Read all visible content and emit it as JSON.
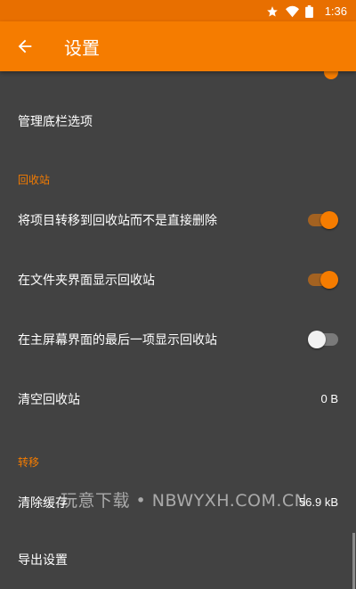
{
  "status_bar": {
    "time": "1:36",
    "icons": [
      "star-icon",
      "wifi-icon",
      "battery-icon"
    ]
  },
  "app_bar": {
    "title": "设置",
    "back_icon": "arrow-left-icon"
  },
  "colors": {
    "accent": "#f57c00",
    "background": "#424242",
    "status_bar": "#e86f00"
  },
  "settings": {
    "manage_bottom_bar": "管理底栏选项",
    "recycle_bin": {
      "header": "回收站",
      "move_to_recycle_bin": {
        "label": "将项目转移到回收站而不是直接删除",
        "enabled": true
      },
      "show_in_folder": {
        "label": "在文件夹界面显示回收站",
        "enabled": true
      },
      "show_last_on_home": {
        "label": "在主屏幕界面的最后一项显示回收站",
        "enabled": false
      },
      "empty_recycle_bin": {
        "label": "清空回收站",
        "value": "0 B"
      }
    },
    "migration": {
      "header": "转移",
      "clear_cache": {
        "label": "清除缓存",
        "value": "56.9 kB"
      },
      "export_settings": {
        "label": "导出设置"
      }
    }
  },
  "watermark": "玩意下载 • NBWYXH.COM.CN"
}
